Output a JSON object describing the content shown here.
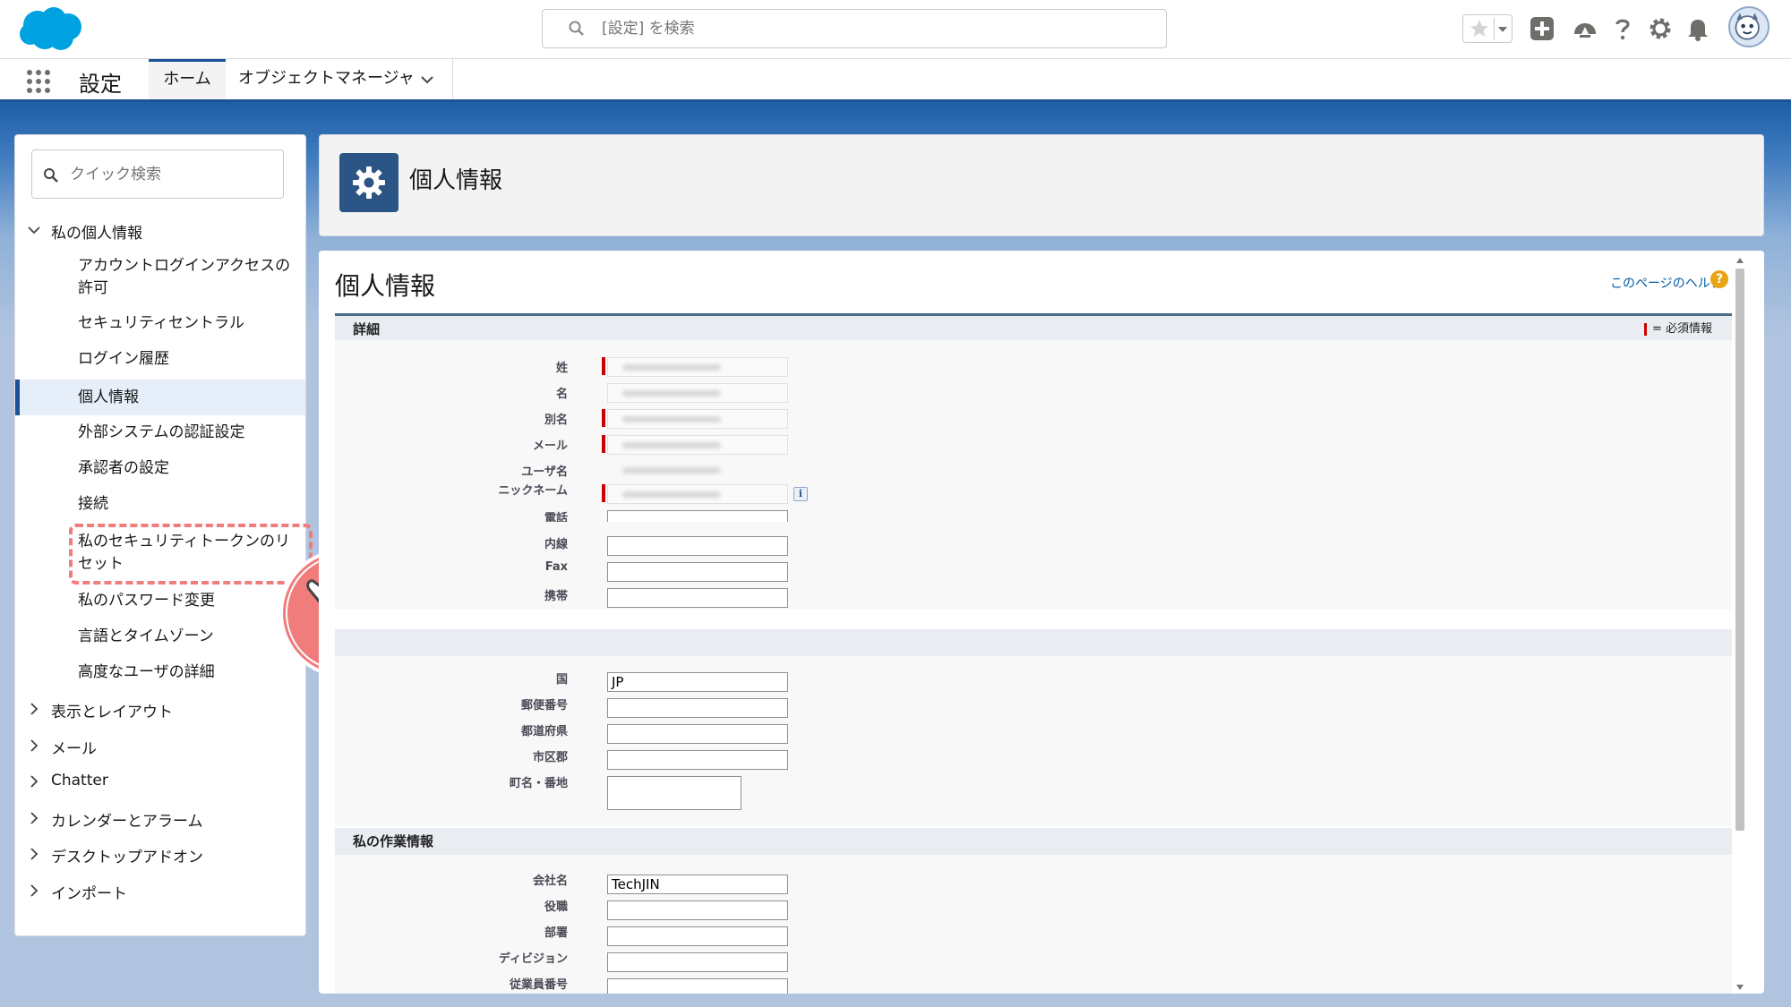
{
  "header": {
    "search_placeholder": "[設定] を検索"
  },
  "nav": {
    "app_name": "設定",
    "tab_home": "ホーム",
    "tab_object_manager": "オブジェクトマネージャ"
  },
  "sidebar": {
    "quick_find_placeholder": "クイック検索",
    "groups": [
      {
        "label": "私の個人情報",
        "expanded": true
      },
      {
        "label": "表示とレイアウト",
        "expanded": false
      },
      {
        "label": "メール",
        "expanded": false
      },
      {
        "label": "Chatter",
        "expanded": false
      },
      {
        "label": "カレンダーとアラーム",
        "expanded": false
      },
      {
        "label": "デスクトップアドオン",
        "expanded": false
      },
      {
        "label": "インポート",
        "expanded": false
      }
    ],
    "items": [
      {
        "label": "アカウントログインアクセスの許可"
      },
      {
        "label": "セキュリティセントラル"
      },
      {
        "label": "ログイン履歴"
      },
      {
        "label": "個人情報",
        "active": true
      },
      {
        "label": "外部システムの認証設定"
      },
      {
        "label": "承認者の設定"
      },
      {
        "label": "接続"
      },
      {
        "label": "私のセキュリティトークンのリセット",
        "highlighted": true
      },
      {
        "label": "私のパスワード変更"
      },
      {
        "label": "言語とタイムゾーン"
      },
      {
        "label": "高度なユーザの詳細"
      }
    ]
  },
  "page_header": {
    "title": "個人情報"
  },
  "content": {
    "title": "個人情報",
    "help_link": "このページのヘルプ",
    "help_icon": "?",
    "required_legend": "= 必須情報",
    "info_icon": "i",
    "sections": [
      {
        "title": "詳細",
        "fields": [
          {
            "label": "姓",
            "value": "",
            "blurred": true,
            "required": true
          },
          {
            "label": "名",
            "value": "",
            "blurred": true
          },
          {
            "label": "別名",
            "value": "",
            "blurred": true,
            "required": true
          },
          {
            "label": "メール",
            "value": "",
            "blurred": true,
            "required": true
          },
          {
            "label": "ユーザ名",
            "value": "",
            "blurred": true
          },
          {
            "label": "ニックネーム",
            "value": "",
            "blurred": true,
            "required": true
          },
          {
            "label": "電話",
            "value": ""
          },
          {
            "label": "内線",
            "value": ""
          },
          {
            "label": "Fax",
            "value": ""
          },
          {
            "label": "携帯",
            "value": ""
          }
        ]
      },
      {
        "title": "",
        "fields": [
          {
            "label": "国",
            "value": "JP"
          },
          {
            "label": "郵便番号",
            "value": ""
          },
          {
            "label": "都道府県",
            "value": ""
          },
          {
            "label": "市区郡",
            "value": ""
          },
          {
            "label": "町名・番地",
            "value": ""
          }
        ]
      },
      {
        "title": "私の作業情報",
        "fields": [
          {
            "label": "会社名",
            "value": "TechJIN"
          },
          {
            "label": "役職",
            "value": ""
          },
          {
            "label": "部署",
            "value": ""
          },
          {
            "label": "ディビジョン",
            "value": ""
          },
          {
            "label": "従業員番号",
            "value": ""
          }
        ]
      }
    ]
  },
  "colors": {
    "brand_blue": "#1b5297",
    "salesforce_cloud": "#00a1e0",
    "highlight_red": "#f07c7c",
    "required_red": "#cc0000"
  }
}
